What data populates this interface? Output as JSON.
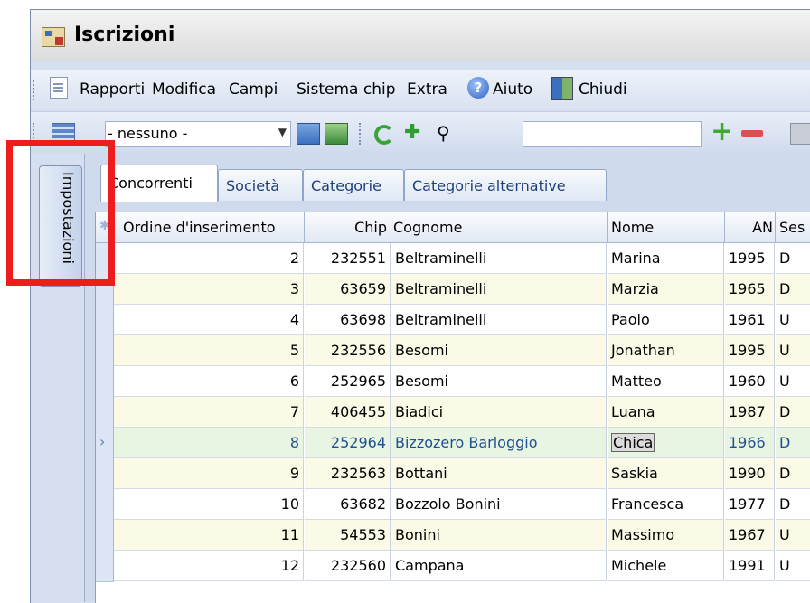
{
  "window": {
    "title": "Iscrizioni"
  },
  "menu": {
    "items": [
      "Rapporti",
      "Modifica",
      "Campi",
      "Sistema chip",
      "Extra",
      "Aiuto",
      "Chiudi"
    ]
  },
  "toolbar": {
    "filter_value": "- nessuno -",
    "search_value": ""
  },
  "side_tab": {
    "label": "Impostazioni"
  },
  "tabs": [
    "Concorrenti",
    "Società",
    "Categorie",
    "Categorie alternative"
  ],
  "grid": {
    "columns": [
      "Ordine d'inserimento",
      "Chip",
      "Cognome",
      "Nome",
      "AN",
      "Ses"
    ],
    "rows": [
      {
        "ordine": "2",
        "chip": "232551",
        "cognome": "Beltraminelli",
        "nome": "Marina",
        "an": "1995",
        "sesso": "D"
      },
      {
        "ordine": "3",
        "chip": "63659",
        "cognome": "Beltraminelli",
        "nome": "Marzia",
        "an": "1965",
        "sesso": "D"
      },
      {
        "ordine": "4",
        "chip": "63698",
        "cognome": "Beltraminelli",
        "nome": "Paolo",
        "an": "1961",
        "sesso": "U"
      },
      {
        "ordine": "5",
        "chip": "232556",
        "cognome": "Besomi",
        "nome": "Jonathan",
        "an": "1995",
        "sesso": "U"
      },
      {
        "ordine": "6",
        "chip": "252965",
        "cognome": "Besomi",
        "nome": "Matteo",
        "an": "1960",
        "sesso": "U"
      },
      {
        "ordine": "7",
        "chip": "406455",
        "cognome": "Biadici",
        "nome": "Luana",
        "an": "1987",
        "sesso": "D"
      },
      {
        "ordine": "8",
        "chip": "252964",
        "cognome": "Bizzozero Barloggio",
        "nome": "Chica",
        "an": "1966",
        "sesso": "D"
      },
      {
        "ordine": "9",
        "chip": "232563",
        "cognome": "Bottani",
        "nome": "Saskia",
        "an": "1990",
        "sesso": "D"
      },
      {
        "ordine": "10",
        "chip": "63682",
        "cognome": "Bozzolo Bonini",
        "nome": "Francesca",
        "an": "1977",
        "sesso": "D"
      },
      {
        "ordine": "11",
        "chip": "54553",
        "cognome": "Bonini",
        "nome": "Massimo",
        "an": "1967",
        "sesso": "U"
      },
      {
        "ordine": "12",
        "chip": "232560",
        "cognome": "Campana",
        "nome": "Michele",
        "an": "1991",
        "sesso": "U"
      }
    ],
    "selected_row": 6
  },
  "colors": {
    "row_even": "#ffffff",
    "row_odd": "#fafae6",
    "row_selected": "#e9f5e3",
    "selected_text": "#1e4f8f",
    "highlight_box": "#ee1c1c"
  }
}
